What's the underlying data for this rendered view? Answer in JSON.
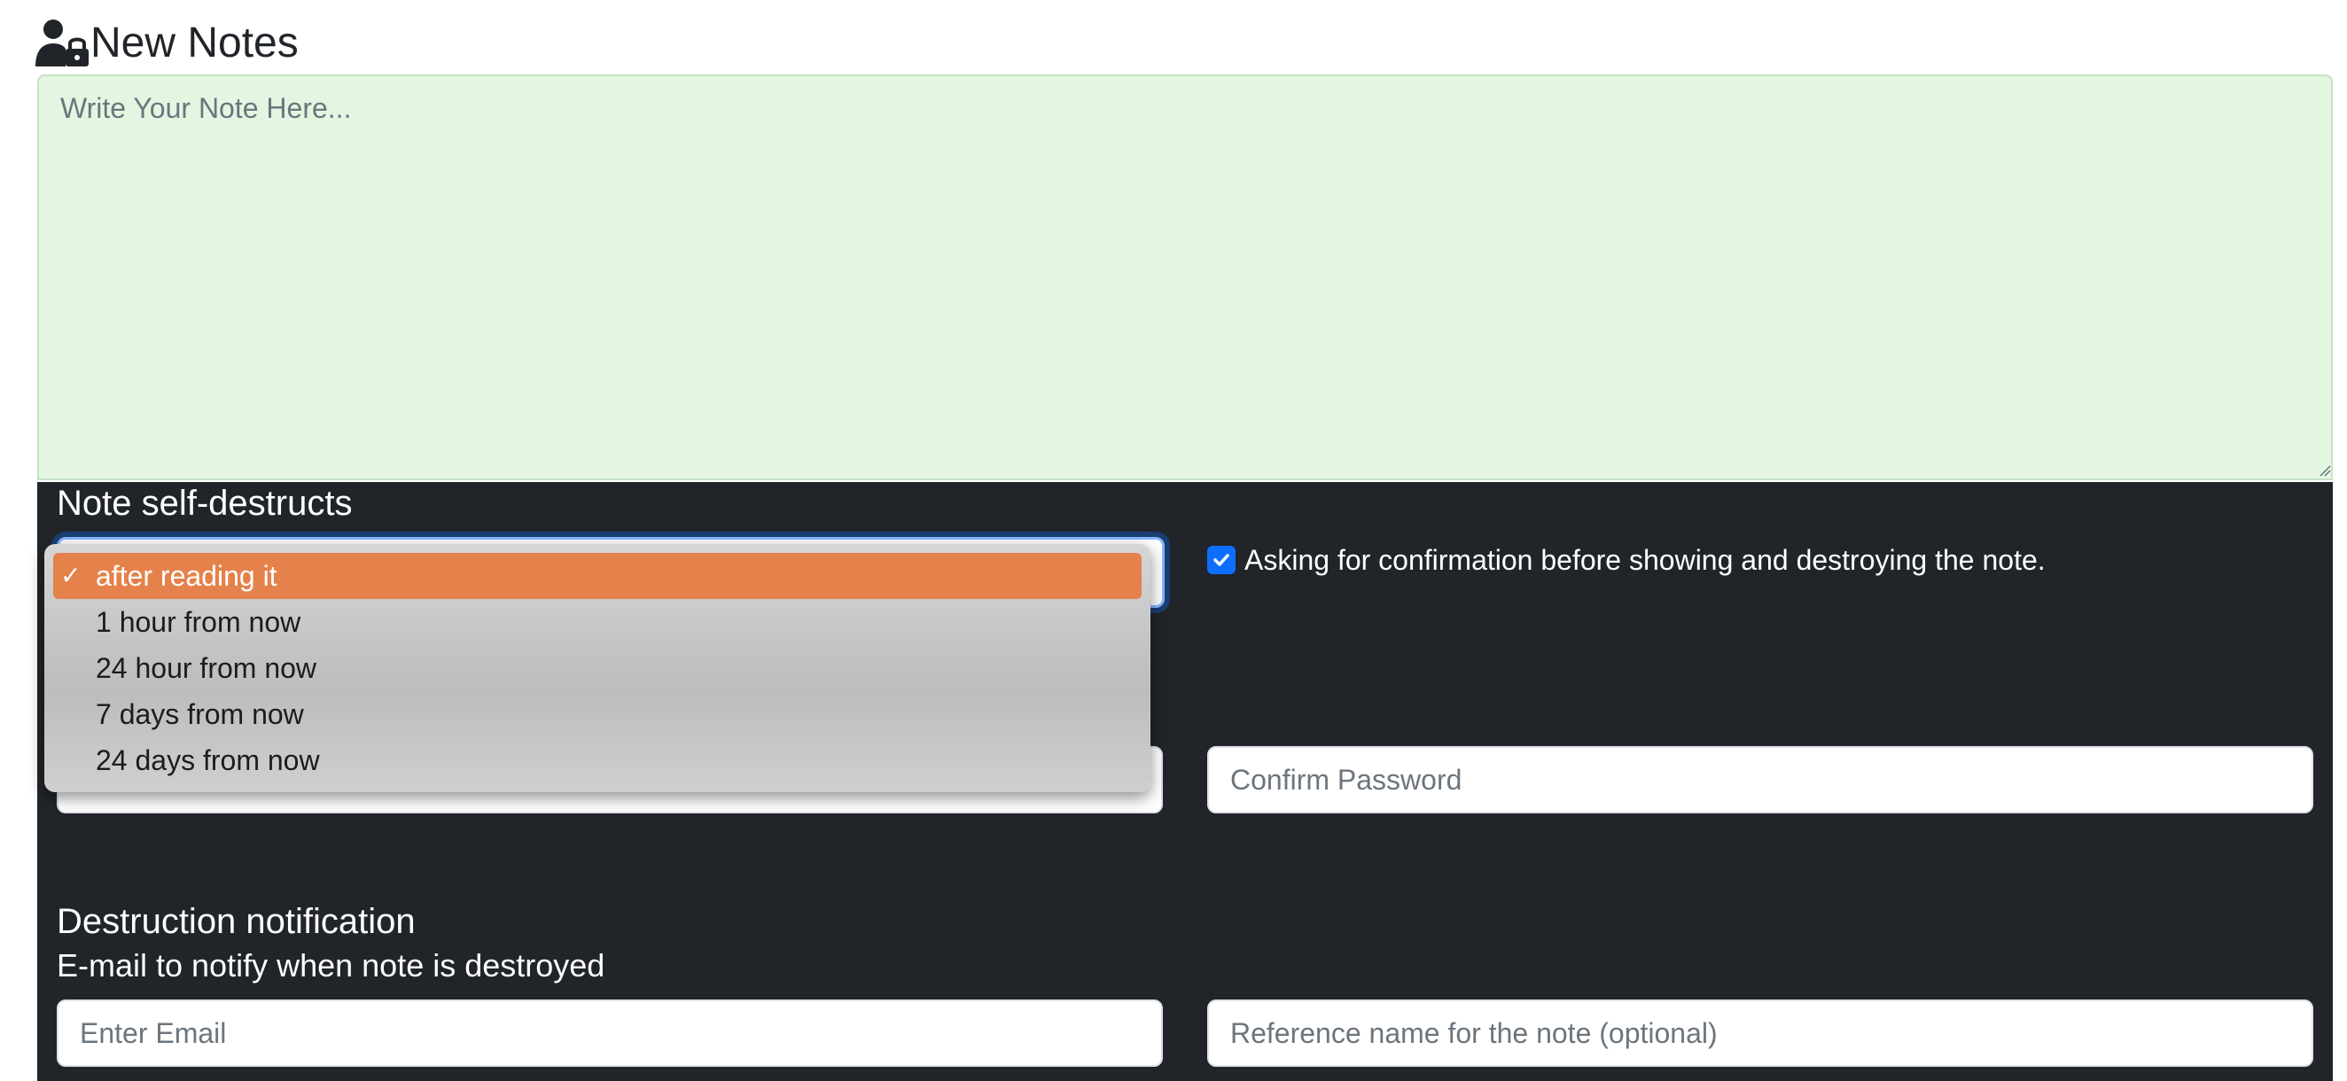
{
  "header": {
    "title": "New Notes",
    "icon": "user-lock-icon"
  },
  "note": {
    "placeholder": "Write Your Note Here..."
  },
  "self_destruct": {
    "heading": "Note self-destructs",
    "options": [
      {
        "label": "after reading it",
        "selected": true
      },
      {
        "label": "1 hour from now",
        "selected": false
      },
      {
        "label": "24 hour from now",
        "selected": false
      },
      {
        "label": "7 days from now",
        "selected": false
      },
      {
        "label": "24 days from now",
        "selected": false
      }
    ],
    "check_mark": "✓",
    "confirm": {
      "checked": true,
      "label": "Asking for confirmation before showing and destroying the note."
    }
  },
  "password": {
    "confirm_placeholder": "Confirm Password"
  },
  "notification": {
    "heading": "Destruction notification",
    "subheading": "E-mail to notify when note is destroyed",
    "email_placeholder": "Enter Email",
    "reference_placeholder": "Reference name for the note (optional)"
  },
  "colors": {
    "note_bg": "#e4f6e1",
    "panel_bg": "#212529",
    "selected_option": "#e5814a",
    "checkbox": "#0d6efd"
  }
}
